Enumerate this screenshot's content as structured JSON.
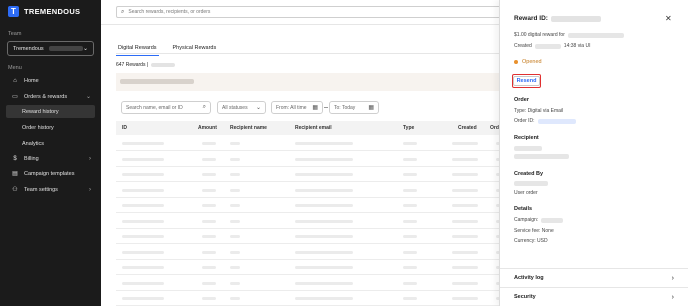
{
  "brand": {
    "name": "TREMENDOUS",
    "mark": "T"
  },
  "sidebar": {
    "team_label": "Team",
    "team_value": "Tremendous",
    "menu_label": "Menu",
    "items": [
      {
        "label": "Home",
        "icon": "home-icon"
      },
      {
        "label": "Orders & rewards",
        "icon": "orders-icon",
        "expanded": true
      },
      {
        "label": "Reward history",
        "sub": true,
        "active": true
      },
      {
        "label": "Order history",
        "sub": true
      },
      {
        "label": "Analytics",
        "sub": true
      },
      {
        "label": "Billing",
        "icon": "dollar-icon"
      },
      {
        "label": "Campaign templates",
        "icon": "template-icon"
      },
      {
        "label": "Team settings",
        "icon": "team-icon"
      }
    ]
  },
  "search": {
    "placeholder": "Search rewards, recipients, or orders"
  },
  "tabs": [
    "Digital Rewards",
    "Physical Rewards"
  ],
  "count_label": "647 Rewards |",
  "filters": {
    "search_placeholder": "Search name, email or ID",
    "status": "All statuses",
    "from": "From: All time",
    "to": "To: Today"
  },
  "table": {
    "columns": [
      "ID",
      "Amount",
      "Recipient name",
      "Recipient email",
      "Type",
      "Created",
      "Ord"
    ]
  },
  "panel": {
    "title": "Reward ID:",
    "amount_text": "$1.00 digital reward for",
    "created_label": "Created",
    "created_suffix": "14:38 via UI",
    "status": "Opened",
    "resend_label": "Resend",
    "order_heading": "Order",
    "order_type": "Type: Digital via Email",
    "order_id_label": "Order ID:",
    "recipient_heading": "Recipient",
    "created_by_heading": "Created By",
    "created_by_value": "User order",
    "details_heading": "Details",
    "campaign_label": "Campaign:",
    "service_fee": "Service fee: None",
    "currency": "Currency: USD",
    "activity_log": "Activity log",
    "security": "Security"
  },
  "colors": {
    "accent": "#2d6cf6",
    "sidebar": "#1b1b1b",
    "status_opened": "#e8912d",
    "highlight": "#e03030"
  }
}
